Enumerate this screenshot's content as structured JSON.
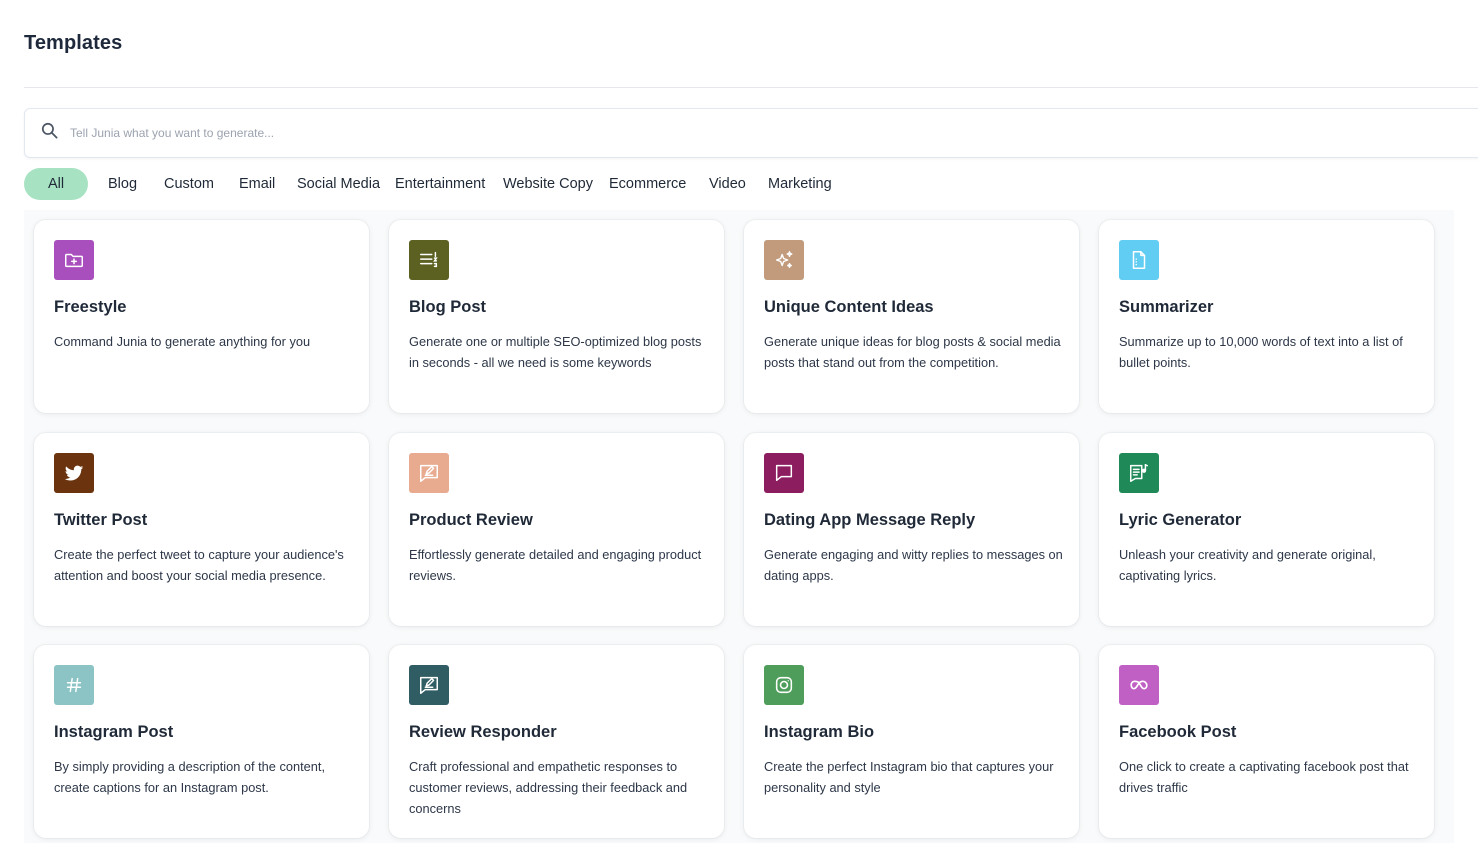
{
  "page": {
    "title": "Templates"
  },
  "search": {
    "placeholder": "Tell Junia what you want to generate..."
  },
  "tabs": [
    "All",
    "Blog",
    "Custom",
    "Email",
    "Social Media",
    "Entertainment",
    "Website Copy",
    "Ecommerce",
    "Video",
    "Marketing"
  ],
  "active_tab": "All",
  "colors": {
    "active_tab_bg": "#a7e3c3",
    "freestyle": "#a94fbd",
    "blog_post": "#5c6122",
    "unique_content_ideas": "#c19b7c",
    "summarizer": "#62cdf2",
    "twitter_post": "#6b340f",
    "product_review": "#e8ab90",
    "dating_app_message_reply": "#8c1d5f",
    "lyric_generator": "#1f8a58",
    "instagram_post": "#8cc4c6",
    "review_responder": "#305c63",
    "instagram_bio": "#4f9d5a",
    "facebook_post": "#c060c5"
  },
  "templates": [
    {
      "title": "Freestyle",
      "description": "Command Junia to generate anything for you",
      "icon": "folder-plus-icon"
    },
    {
      "title": "Blog Post",
      "description": "Generate one or multiple SEO-optimized blog posts in seconds - all we need is some keywords",
      "icon": "list-numbered-icon"
    },
    {
      "title": "Unique Content Ideas",
      "description": "Generate unique ideas for blog posts & social media posts that stand out from the competition.",
      "icon": "sparkles-icon"
    },
    {
      "title": "Summarizer",
      "description": "Summarize up to 10,000 words of text into a list of bullet points.",
      "icon": "document-icon"
    },
    {
      "title": "Twitter Post",
      "description": "Create the perfect tweet to capture your audience's attention and boost your social media presence.",
      "icon": "twitter-bird-icon"
    },
    {
      "title": "Product Review",
      "description": "Effortlessly generate detailed and engaging product reviews.",
      "icon": "message-edit-icon"
    },
    {
      "title": "Dating App Message Reply",
      "description": "Generate engaging and witty replies to messages on dating apps.",
      "icon": "chat-bubble-icon"
    },
    {
      "title": "Lyric Generator",
      "description": "Unleash your creativity and generate original, captivating lyrics.",
      "icon": "music-note-list-icon"
    },
    {
      "title": "Instagram Post",
      "description": "By simply providing a description of the content, create captions for an Instagram post.",
      "icon": "hashtag-icon"
    },
    {
      "title": "Review Responder",
      "description": "Craft professional and empathetic responses to customer reviews, addressing their feedback and concerns",
      "icon": "message-edit-icon"
    },
    {
      "title": "Instagram Bio",
      "description": "Create the perfect Instagram bio that captures your personality and style",
      "icon": "instagram-icon"
    },
    {
      "title": "Facebook Post",
      "description": "One click to create a captivating facebook post that drives traffic",
      "icon": "meta-infinity-icon"
    }
  ]
}
